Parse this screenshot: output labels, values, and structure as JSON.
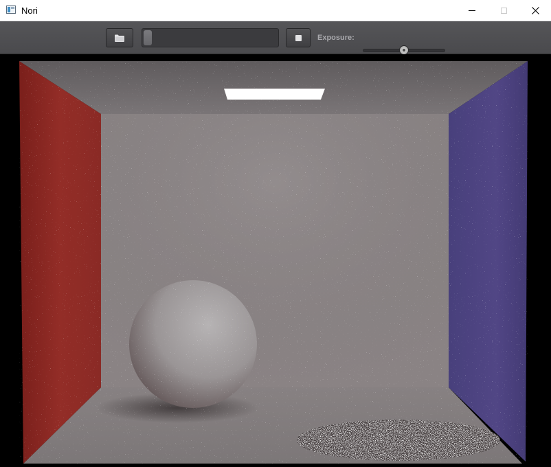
{
  "window": {
    "title": "Nori",
    "icon": "app-icon",
    "controls": [
      "minimize-icon",
      "maximize-icon",
      "close-icon"
    ]
  },
  "toolbar": {
    "open_icon": "folder-open-icon",
    "progress": 0.06,
    "stop_icon": "stop-icon",
    "exposure_label": "Exposure:",
    "exposure_level": 0.5
  },
  "render": {
    "scene": "cornell-box",
    "colors": {
      "left_wall": "#8c2a24",
      "right_wall": "#4d4384",
      "back_wall": "#898082",
      "ceiling": "#6e6a6c",
      "floor": "#827d7e",
      "light": "#ffffff",
      "sphere": "#a7a4a5"
    }
  }
}
